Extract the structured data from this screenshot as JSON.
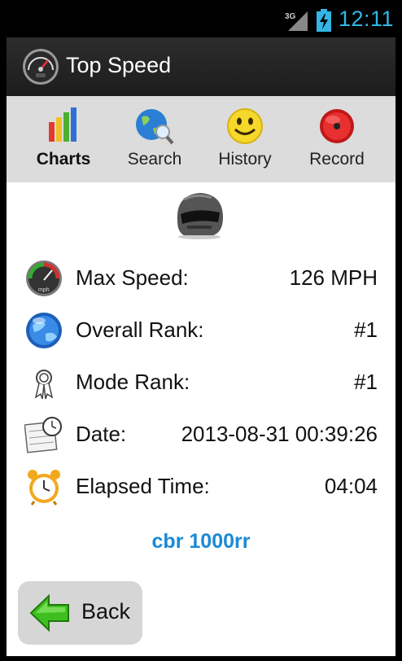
{
  "status_bar": {
    "network": "3G",
    "time": "12:11"
  },
  "action_bar": {
    "title": "Top Speed",
    "icon": "speedometer-icon"
  },
  "toolbar": {
    "items": [
      {
        "label": "Charts",
        "icon": "bar-chart-icon",
        "active": true
      },
      {
        "label": "Search",
        "icon": "globe-search-icon",
        "active": false
      },
      {
        "label": "History",
        "icon": "smiley-icon",
        "active": false
      },
      {
        "label": "Record",
        "icon": "record-icon",
        "active": false
      }
    ]
  },
  "stats": [
    {
      "label": "Max Speed:",
      "value": "126 MPH",
      "icon": "speedometer-icon"
    },
    {
      "label": "Overall Rank:",
      "value": "#1",
      "icon": "globe-icon"
    },
    {
      "label": "Mode Rank:",
      "value": "#1",
      "icon": "ribbon-icon"
    },
    {
      "label": "Date:",
      "value": "2013-08-31 00:39:26",
      "icon": "calendar-clock-icon"
    },
    {
      "label": "Elapsed Time:",
      "value": "04:04",
      "icon": "alarm-clock-icon"
    }
  ],
  "vehicle_name": "cbr 1000rr",
  "back_button": {
    "label": "Back",
    "icon": "green-arrow-left-icon"
  },
  "colors": {
    "accent_blue": "#1a8ad4",
    "clock_blue": "#33b5e5",
    "toolbar_bg": "#dcdcdc",
    "action_bar_bg": "#222222"
  }
}
